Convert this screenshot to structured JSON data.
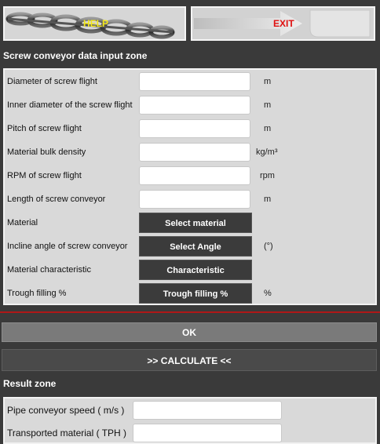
{
  "header": {
    "help_label": "HELP",
    "exit_label": "EXIT"
  },
  "input_zone": {
    "title": "Screw conveyor data input zone",
    "rows": [
      {
        "label": "Diameter of screw flight",
        "value": "",
        "unit": "m"
      },
      {
        "label": "Inner diameter of the screw flight",
        "value": "",
        "unit": "m"
      },
      {
        "label": "Pitch of screw flight",
        "value": "",
        "unit": "m"
      },
      {
        "label": "Material bulk density",
        "value": "",
        "unit": "kg/m³"
      },
      {
        "label": "RPM of screw flight",
        "value": "",
        "unit": "rpm"
      },
      {
        "label": "Length of screw conveyor",
        "value": "",
        "unit": "m"
      },
      {
        "label": "Material",
        "button": "Select material",
        "unit": ""
      },
      {
        "label": "Incline angle of screw conveyor",
        "button": "Select Angle",
        "unit": "(°)"
      },
      {
        "label": "Material characteristic",
        "button": "Characteristic",
        "unit": ""
      },
      {
        "label": "Trough filling %",
        "button": "Trough filling %",
        "unit": "%"
      }
    ]
  },
  "actions": {
    "ok_label": "OK",
    "calculate_label": ">> CALCULATE <<"
  },
  "result_zone": {
    "title": "Result zone",
    "rows": [
      {
        "label": "Pipe conveyor speed ( m/s )",
        "value": ""
      },
      {
        "label": "Transported material ( TPH )",
        "value": ""
      }
    ]
  },
  "colors": {
    "background": "#3a3a3a",
    "panel": "#d9d9d9",
    "help_text": "#f3e61a",
    "exit_text": "#e01010",
    "separator": "#b01818"
  }
}
